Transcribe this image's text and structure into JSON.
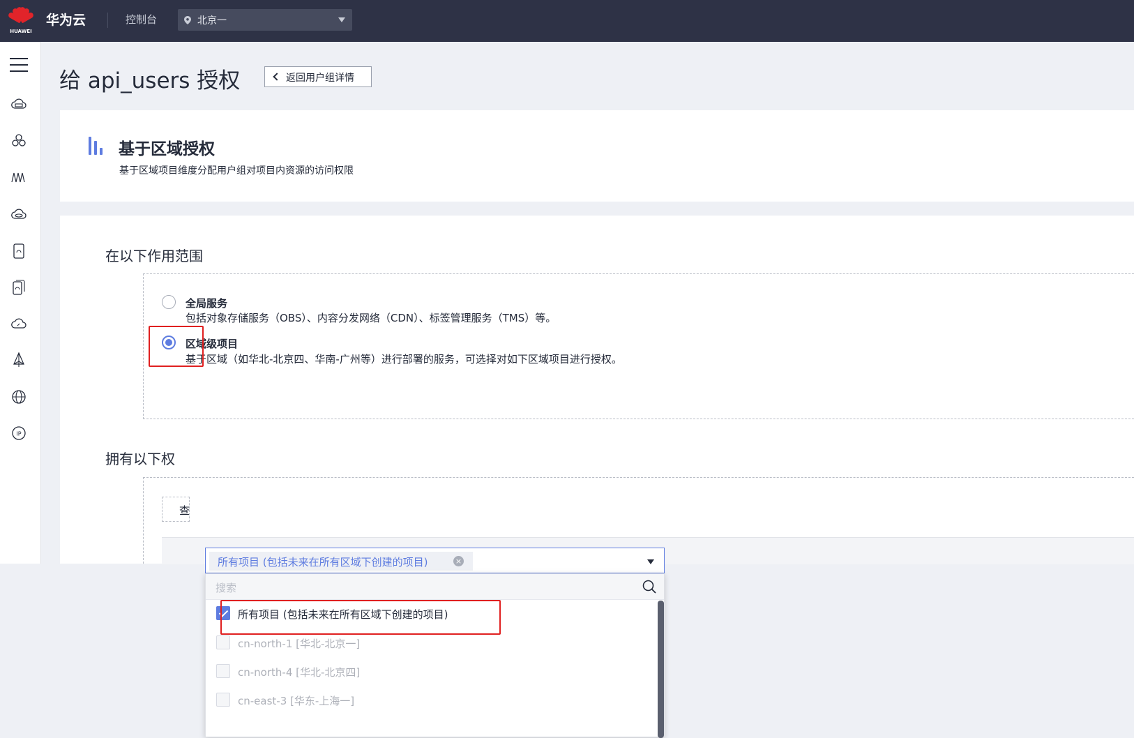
{
  "topbar": {
    "logo_text": "HUAWEI",
    "brand": "华为云",
    "console": "控制台",
    "region": "北京一"
  },
  "sidenav": {
    "icons": [
      "menu-icon",
      "cloud-server-icon",
      "cluster-icon",
      "monitoring-icon",
      "disk-icon",
      "storage-icon",
      "storage-backup-icon",
      "cloud-icon",
      "network-icon",
      "web-icon",
      "ip-icon"
    ]
  },
  "page": {
    "title": "给 api_users 授权",
    "back_button": "返回用户组详情"
  },
  "section": {
    "title": "基于区域授权",
    "description": "基于区域项目维度分配用户组对项目内资源的访问权限"
  },
  "scope": {
    "label": "在以下作用范围",
    "options": [
      {
        "title": "全局服务",
        "desc": "包括对象存储服务（OBS）、内容分发网络（CDN）、标签管理服务（TMS）等。",
        "checked": false
      },
      {
        "title": "区域级项目",
        "desc": "基于区域（如华北-北京四、华南-广州等）进行部署的服务，可选择对如下区域项目进行授权。",
        "checked": true
      }
    ]
  },
  "permissions": {
    "label": "拥有以下权",
    "button_fragment": "查"
  },
  "select": {
    "tag": "所有项目 (包括未来在所有区域下创建的项目)",
    "search_placeholder": "搜索",
    "items": [
      {
        "label": "所有项目 (包括未来在所有区域下创建的项目)",
        "checked": true,
        "disabled": false
      },
      {
        "label": "cn-north-1 [华北-北京一]",
        "checked": false,
        "disabled": true
      },
      {
        "label": "cn-north-4 [华北-北京四]",
        "checked": false,
        "disabled": true
      },
      {
        "label": "cn-east-3 [华东-上海一]",
        "checked": false,
        "disabled": true
      }
    ]
  },
  "colors": {
    "topbar": "#2e3246",
    "accent": "#5e7ce0",
    "highlight": "#e02020",
    "logo_red": "#e1242a"
  }
}
